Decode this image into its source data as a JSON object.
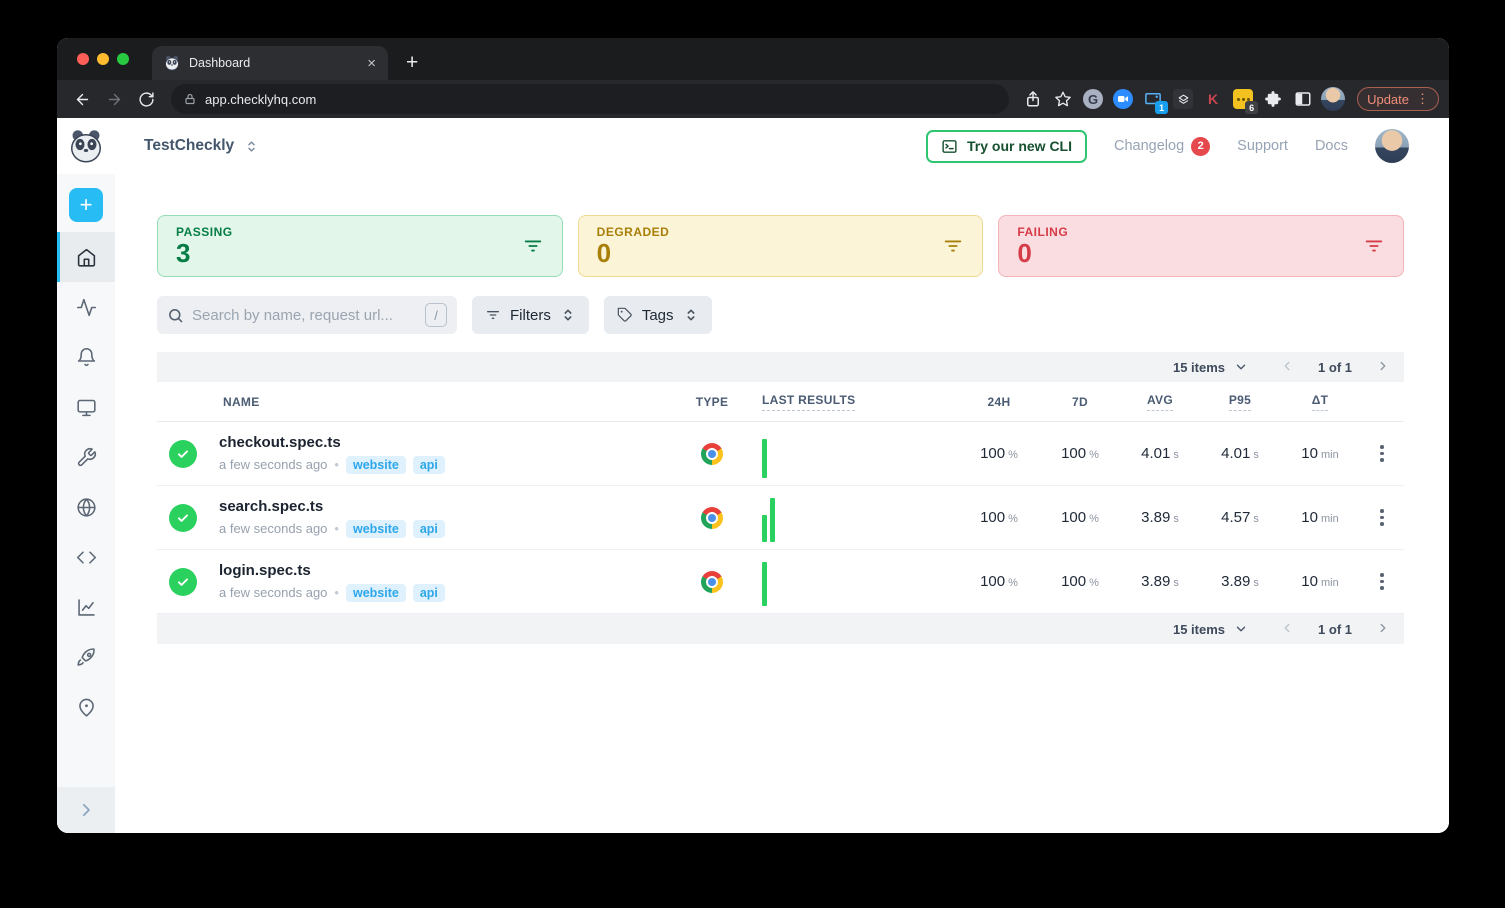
{
  "browser": {
    "tab_title": "Dashboard",
    "close_glyph": "×",
    "new_tab_glyph": "+",
    "url": "app.checklyhq.com",
    "update_label": "Update",
    "menu_dots": "⋮",
    "extensions": {
      "grammarly_letter": "G",
      "kagi_letter": "K",
      "cast_badge": "1",
      "more_badge": "6"
    }
  },
  "header": {
    "workspace": "TestCheckly",
    "cli_button_label": "Try our new CLI",
    "changelog_label": "Changelog",
    "changelog_badge": "2",
    "support_label": "Support",
    "docs_label": "Docs"
  },
  "sidebar": {
    "icon_items": [
      "plus",
      "home",
      "activity",
      "bell",
      "monitor",
      "wrench",
      "globe",
      "code",
      "chart",
      "rocket",
      "map-pin",
      "expand"
    ],
    "plus_glyph": "+"
  },
  "cards": [
    {
      "label": "PASSING",
      "value": "3",
      "fg": "#077d46",
      "bg": "#e2f6ea",
      "border": "#97dcb7"
    },
    {
      "label": "DEGRADED",
      "value": "0",
      "fg": "#a77f09",
      "bg": "#fcf4d7",
      "border": "#eeda92"
    },
    {
      "label": "FAILING",
      "value": "0",
      "fg": "#d63c47",
      "bg": "#fadde0",
      "border": "#f2b3b8"
    }
  ],
  "toolbar": {
    "search_placeholder": "Search by name, request url...",
    "search_shortcut": "/",
    "filters_label": "Filters",
    "tags_label": "Tags"
  },
  "table": {
    "pagination": {
      "items": "15 items",
      "page": "1 of 1"
    },
    "columns": [
      "NAME",
      "TYPE",
      "LAST RESULTS",
      "24H",
      "7D",
      "AVG",
      "P95",
      "ΔT"
    ],
    "rows": [
      {
        "name": "checkout.spec.ts",
        "time": "a few seconds ago",
        "tags": [
          "website",
          "api"
        ],
        "type": "chrome",
        "bars": [
          0.88
        ],
        "cells": [
          {
            "v": "100",
            "u": "%"
          },
          {
            "v": "100",
            "u": "%"
          },
          {
            "v": "4.01",
            "u": "s"
          },
          {
            "v": "4.01",
            "u": "s"
          },
          {
            "v": "10",
            "u": "min"
          }
        ]
      },
      {
        "name": "search.spec.ts",
        "time": "a few seconds ago",
        "tags": [
          "website",
          "api"
        ],
        "type": "chrome",
        "bars": [
          0.62,
          1
        ],
        "cells": [
          {
            "v": "100",
            "u": "%"
          },
          {
            "v": "100",
            "u": "%"
          },
          {
            "v": "3.89",
            "u": "s"
          },
          {
            "v": "4.57",
            "u": "s"
          },
          {
            "v": "10",
            "u": "min"
          }
        ]
      },
      {
        "name": "login.spec.ts",
        "time": "a few seconds ago",
        "tags": [
          "website",
          "api"
        ],
        "type": "chrome",
        "bars": [
          1
        ],
        "cells": [
          {
            "v": "100",
            "u": "%"
          },
          {
            "v": "100",
            "u": "%"
          },
          {
            "v": "3.89",
            "u": "s"
          },
          {
            "v": "3.89",
            "u": "s"
          },
          {
            "v": "10",
            "u": "min"
          }
        ]
      }
    ]
  },
  "glyphs": {
    "bullet": "•"
  },
  "theme": {
    "accent": "#27bdf4",
    "success": "#2bd15e",
    "tag_bg": "#def1fc",
    "tag_fg": "#2ea7ea"
  }
}
